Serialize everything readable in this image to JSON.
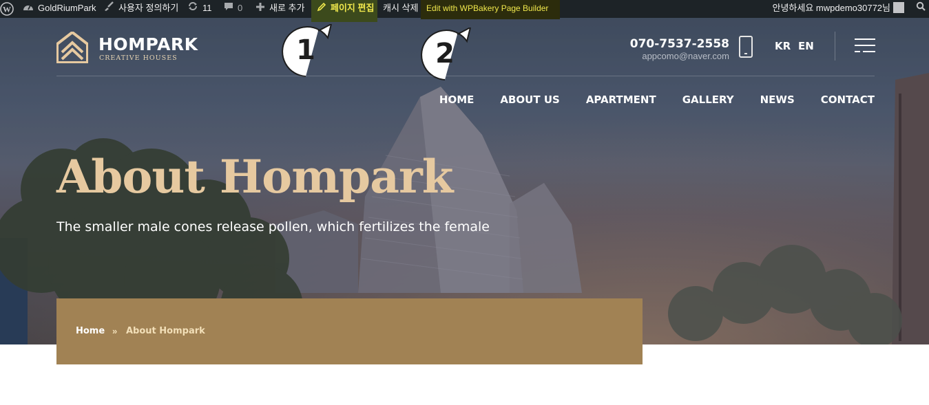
{
  "adminbar": {
    "site_name": "GoldRiumPark",
    "customize": "사용자 정의하기",
    "updates_count": "11",
    "comments_count": "0",
    "new": "새로 추가",
    "edit_page": "페이지 편집",
    "cache_clear": "캐시 삭제",
    "wpbakery": "Edit with WPBakery Page Builder",
    "greeting": "안녕하세요 mwpdemo30772님"
  },
  "header": {
    "brand": "HOMPARK",
    "tagline": "CREATIVE HOUSES",
    "phone": "070-7537-2558",
    "email": "appcomo@naver.com",
    "lang_kr": "KR",
    "lang_en": "EN"
  },
  "callouts": [
    "1",
    "2"
  ],
  "nav": [
    "HOME",
    "ABOUT US",
    "APARTMENT",
    "GALLERY",
    "NEWS",
    "CONTACT"
  ],
  "hero": {
    "title": "About Hompark",
    "subtitle": "The smaller male cones release pollen, which fertilizes the female"
  },
  "breadcrumb": {
    "home": "Home",
    "separator": "»",
    "current": "About Hompark"
  },
  "colors": {
    "accent": "#e6c9a0",
    "breadcrumb_bg": "#a18254",
    "adminbar_bg": "#1d2327"
  }
}
